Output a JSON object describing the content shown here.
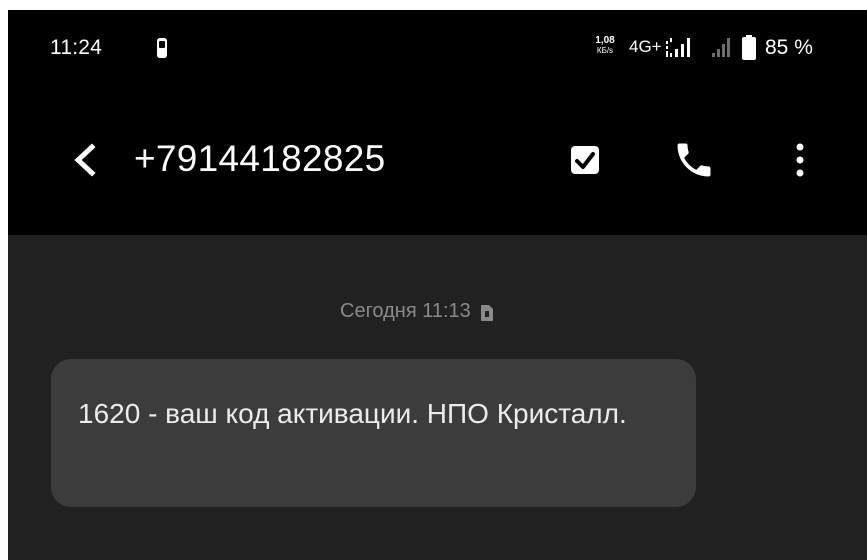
{
  "status_bar": {
    "time": "11:24",
    "net_speed_value": "1,08",
    "net_speed_unit": "КБ/s",
    "network_type": "4G+",
    "battery": "85 %",
    "icons": [
      "notification-icon",
      "signal-icon",
      "signal-weak-icon",
      "battery-icon"
    ]
  },
  "app_bar": {
    "contact": "+79144182825",
    "actions": [
      "back-icon",
      "select-icon",
      "call-icon",
      "more-icon"
    ]
  },
  "conversation": {
    "date": "Сегодня 11:13",
    "messages": [
      {
        "text": "1620 - ваш код активации. НПО Кристалл."
      }
    ]
  },
  "colors": {
    "background": "#212121",
    "top_bar": "#000000",
    "bubble": "#3c3c3c",
    "date_text": "#8a8a8a"
  }
}
